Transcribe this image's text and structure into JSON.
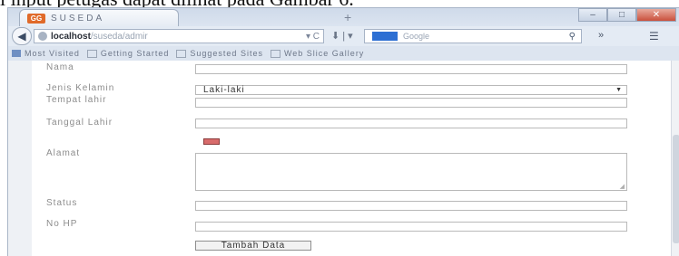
{
  "document": {
    "caption": "i input petugas dapat dilihat pada Gambar 6."
  },
  "browser": {
    "tab_favicon_text": "GG",
    "tab_title": "SUSEDA",
    "new_tab": "+",
    "url_host": "localhost",
    "url_path": "/suseda/admir",
    "url_controls": "▾ C",
    "search_placeholder": "Google",
    "bookmarks": {
      "most_visited": "Most Visited",
      "getting_started": "Getting Started",
      "suggested_sites": "Suggested Sites",
      "web_slice_gallery": "Web Slice Gallery"
    }
  },
  "form": {
    "nama_label": "Nama",
    "jenis_kelamin_label": "Jenis Kelamin",
    "jenis_kelamin_value": "Laki-laki",
    "tempat_lahir_label": "Tempat lahir",
    "tanggal_lahir_label": "Tanggal Lahir",
    "alamat_label": "Alamat",
    "status_label": "Status",
    "no_hp_label": "No HP",
    "submit_label": "Tambah Data"
  }
}
